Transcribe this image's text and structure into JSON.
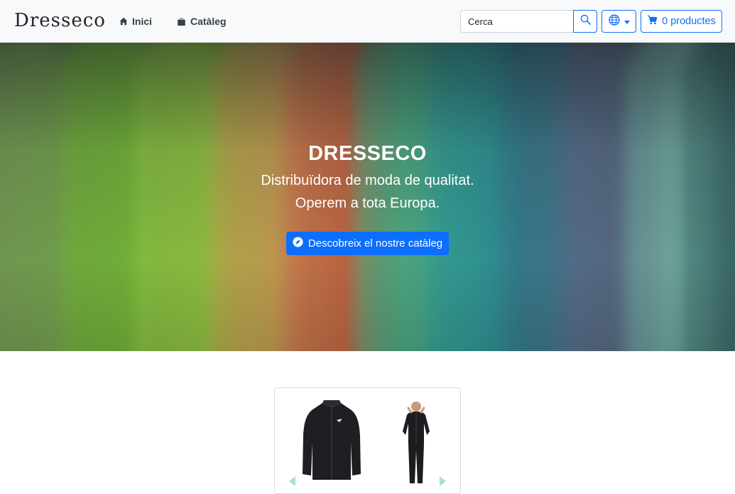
{
  "navbar": {
    "brand": "Dresseco",
    "links": [
      {
        "label": "Inici",
        "icon": "home-icon"
      },
      {
        "label": "Catàleg",
        "icon": "shopping-bag-icon"
      }
    ],
    "search": {
      "placeholder": "Cerca",
      "value": ""
    },
    "language_icon": "globe-icon",
    "cart": {
      "label": "0 productes",
      "icon": "cart-icon"
    }
  },
  "hero": {
    "title": "DRESSECO",
    "subtitle_line1": "Distribuïdora de moda de qualitat.",
    "subtitle_line2": "Operem a tota Europa.",
    "cta_label": "Descobreix el nostre catàleg",
    "cta_icon": "compass-icon"
  },
  "carousel": {
    "prev_icon": "chevron-left-icon",
    "next_icon": "chevron-right-icon"
  },
  "colors": {
    "primary": "#0d6efd",
    "navbar_bg": "#f8f9fa",
    "carousel_arrow": "#a8e2c8"
  }
}
